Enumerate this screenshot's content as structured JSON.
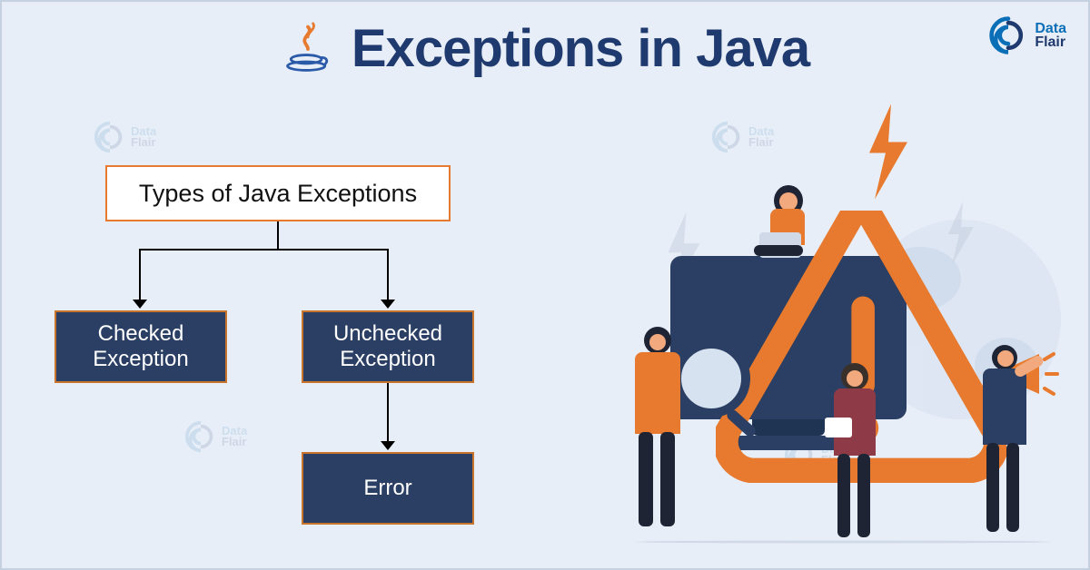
{
  "title": "Exceptions in Java",
  "brand": {
    "word1": "Data",
    "word2": "Flair"
  },
  "diagram": {
    "root": "Types of Java Exceptions",
    "checked": "Checked Exception",
    "unchecked": "Unchecked Exception",
    "error": "Error"
  },
  "icons": {
    "java": "java-logo-icon",
    "warning": "warning-triangle-icon",
    "bolt": "lightning-bolt-icon",
    "globe": "globe-icon",
    "magnifier": "magnifying-glass-icon",
    "megaphone": "megaphone-icon",
    "monitor": "monitor-icon"
  },
  "colors": {
    "bg": "#e8eef7",
    "heading": "#1f3a6e",
    "accent": "#e77a2e",
    "node_fill": "#2a3f63",
    "node_border": "#c9762c",
    "brand_blue": "#0a6fb6"
  }
}
